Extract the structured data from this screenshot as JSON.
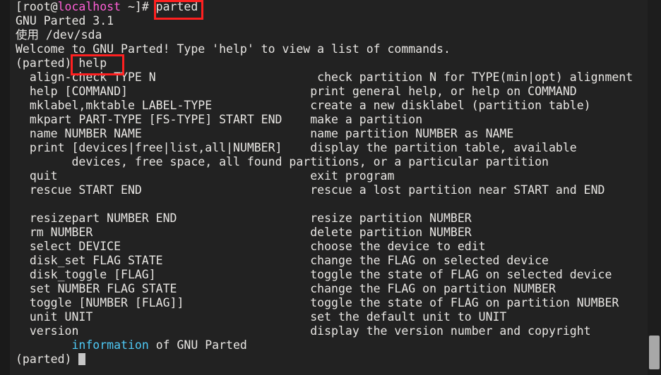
{
  "terminal": {
    "background_color": "#222222",
    "foreground_color": "#e8e6e3",
    "prompt_host_color": "#ff5fd7",
    "highlight_box_color": "#ff2020",
    "link_color": "#4ec9f5",
    "cursor": "block-cursor",
    "shell_prompt": "[root@localhost ~]#",
    "prompt_user": "[root@",
    "prompt_host": "localhost",
    "prompt_tail": " ~]# ",
    "typed_command": "parted",
    "parted_prompt": "(parted)",
    "parted_typed_command": "help"
  },
  "output": {
    "version_line": "GNU Parted 3.1",
    "using_line": "使用 /dev/sda",
    "welcome_line": "Welcome to GNU Parted! Type 'help' to view a list of commands.",
    "commands_group_1": [
      {
        "command": "align-check TYPE N",
        "description": "check partition N for TYPE(min|opt) alignment"
      },
      {
        "command": "help [COMMAND]",
        "description": "print general help, or help on COMMAND"
      },
      {
        "command": "mklabel,mktable LABEL-TYPE",
        "description": "create a new disklabel (partition table)"
      },
      {
        "command": "mkpart PART-TYPE [FS-TYPE] START END",
        "description": "make a partition"
      },
      {
        "command": "name NUMBER NAME",
        "description": "name partition NUMBER as NAME"
      },
      {
        "command": "print [devices|free|list,all|NUMBER]",
        "description": "display the partition table, available"
      },
      {
        "command": "",
        "description": ""
      },
      {
        "command": "quit",
        "description": "exit program"
      },
      {
        "command": "rescue START END",
        "description": "rescue a lost partition near START and END"
      }
    ],
    "print_continuation_command": "devices, free space, all found partitions, or a particular partition",
    "commands_group_2": [
      {
        "command": "resizepart NUMBER END",
        "description": "resize partition NUMBER"
      },
      {
        "command": "rm NUMBER",
        "description": "delete partition NUMBER"
      },
      {
        "command": "select DEVICE",
        "description": "choose the device to edit"
      },
      {
        "command": "disk_set FLAG STATE",
        "description": "change the FLAG on selected device"
      },
      {
        "command": "disk_toggle [FLAG]",
        "description": "toggle the state of FLAG on selected device"
      },
      {
        "command": "set NUMBER FLAG STATE",
        "description": "change the FLAG on partition NUMBER"
      },
      {
        "command": "toggle [NUMBER [FLAG]]",
        "description": "toggle the state of FLAG on partition NUMBER"
      },
      {
        "command": "unit UNIT",
        "description": "set the default unit to UNIT"
      },
      {
        "command": "version",
        "description": "display the version number and copyright"
      }
    ],
    "version_continuation_highlight": "information",
    "version_continuation_rest": " of GNU Parted"
  },
  "lines": {
    "l01_prefix": "[root@",
    "l01_host": "localhost",
    "l01_suffix": " ~]# parted",
    "l02": "GNU Parted 3.1",
    "l03": "使用 /dev/sda",
    "l04": "Welcome to GNU Parted! Type 'help' to view a list of commands.",
    "l05": "(parted) help",
    "l06": "  align-check TYPE N                       check partition N for TYPE(min|opt) alignment",
    "l07": "  help [COMMAND]                          print general help, or help on COMMAND",
    "l08": "  mklabel,mktable LABEL-TYPE              create a new disklabel (partition table)",
    "l09": "  mkpart PART-TYPE [FS-TYPE] START END    make a partition",
    "l10": "  name NUMBER NAME                        name partition NUMBER as NAME",
    "l11": "  print [devices|free|list,all|NUMBER]    display the partition table, available",
    "l12": "        devices, free space, all found partitions, or a particular partition",
    "l13": "  quit                                    exit program",
    "l14": "  rescue START END                        rescue a lost partition near START and END",
    "l15": "",
    "l16": "  resizepart NUMBER END                   resize partition NUMBER",
    "l17": "  rm NUMBER                               delete partition NUMBER",
    "l18": "  select DEVICE                           choose the device to edit",
    "l19": "  disk_set FLAG STATE                     change the FLAG on selected device",
    "l20": "  disk_toggle [FLAG]                      toggle the state of FLAG on selected device",
    "l21": "  set NUMBER FLAG STATE                   change the FLAG on partition NUMBER",
    "l22": "  toggle [NUMBER [FLAG]]                  toggle the state of FLAG on partition NUMBER",
    "l23": "  unit UNIT                               set the default unit to UNIT",
    "l24": "  version                                 display the version number and copyright",
    "l25_indent": "        ",
    "l25_highlight": "information",
    "l25_rest": " of GNU Parted",
    "l26": "(parted) "
  },
  "annotations": {
    "box1_label": "parted",
    "box2_label": "help"
  }
}
